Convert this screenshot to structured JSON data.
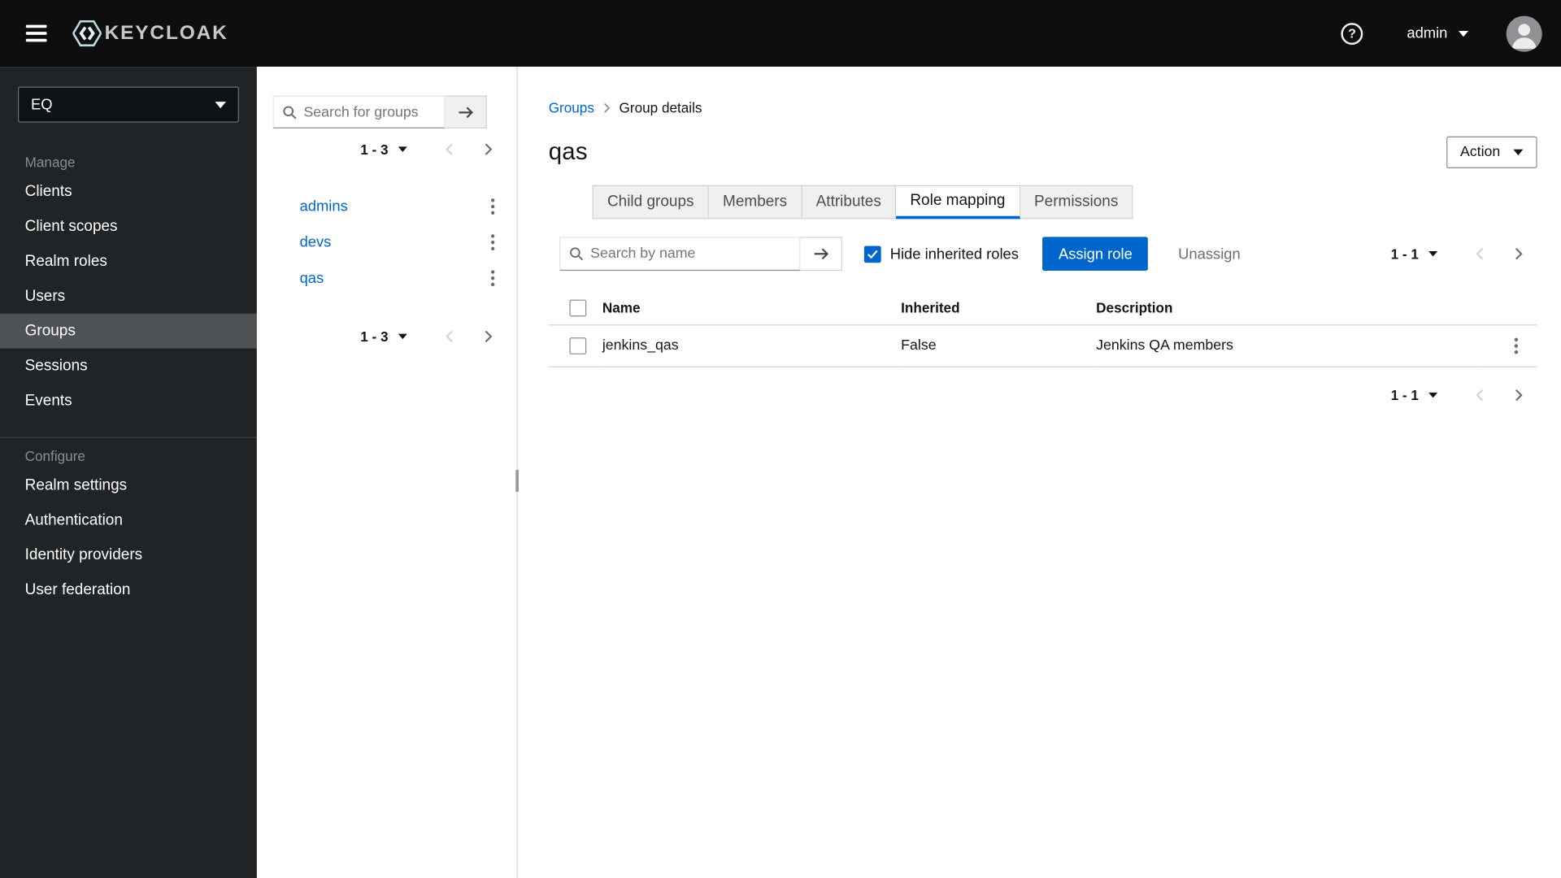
{
  "header": {
    "brand": "KEYCLOAK",
    "user": "admin"
  },
  "sidebar": {
    "realm": "EQ",
    "manage_label": "Manage",
    "manage_items": [
      "Clients",
      "Client scopes",
      "Realm roles",
      "Users",
      "Groups",
      "Sessions",
      "Events"
    ],
    "selected_item": "Groups",
    "configure_label": "Configure",
    "configure_items": [
      "Realm settings",
      "Authentication",
      "Identity providers",
      "User federation"
    ]
  },
  "groups_panel": {
    "search_placeholder": "Search for groups",
    "pagination_label": "1 - 3",
    "groups": [
      "admins",
      "devs",
      "qas"
    ]
  },
  "main": {
    "breadcrumb": {
      "root": "Groups",
      "current": "Group details"
    },
    "title": "qas",
    "action_button": "Action",
    "tabs": [
      "Child groups",
      "Members",
      "Attributes",
      "Role mapping",
      "Permissions"
    ],
    "active_tab": "Role mapping",
    "toolbar": {
      "search_placeholder": "Search by name",
      "hide_inherited": "Hide inherited roles",
      "hide_inherited_checked": true,
      "assign_role": "Assign role",
      "unassign": "Unassign",
      "pagination_label": "1 - 1"
    },
    "table": {
      "headers": [
        "Name",
        "Inherited",
        "Description"
      ],
      "rows": [
        {
          "name": "jenkins_qas",
          "inherited": "False",
          "description": "Jenkins QA members"
        }
      ]
    }
  },
  "icons": {
    "menu": "hamburger",
    "help": "?",
    "caret_down": "▾",
    "search": "magnifier",
    "arrow_right": "→",
    "chevron_left": "‹",
    "chevron_right": "›",
    "kebab": "⋮",
    "check": "✓",
    "breadcrumb_separator": "›",
    "avatar": "person"
  },
  "colors": {
    "accent": "#0066cc",
    "link": "#0066cc",
    "topbar_bg": "#0e0e0e",
    "sidebar_bg": "#212427",
    "sidebar_selected_bg": "#4f5255",
    "border": "#d2d2d2"
  }
}
